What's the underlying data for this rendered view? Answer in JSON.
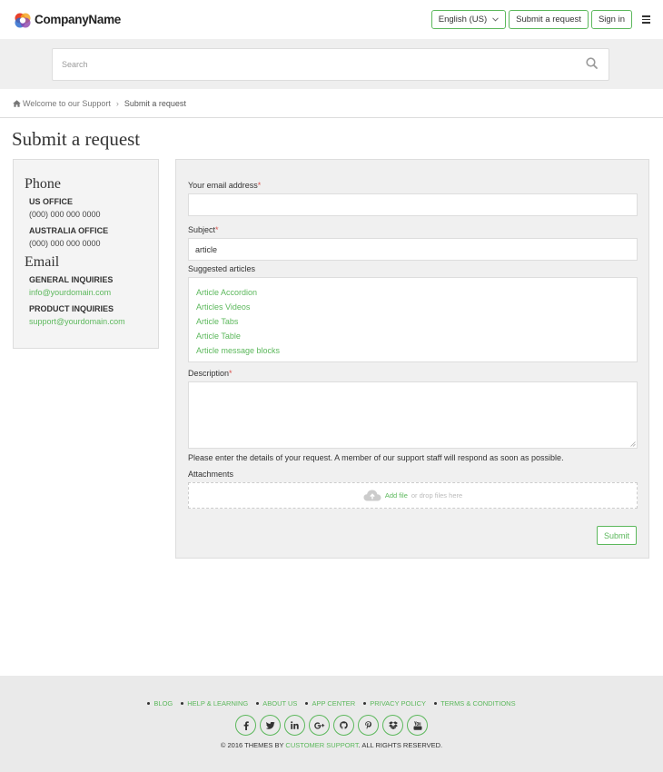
{
  "header": {
    "logo_text": "CompanyName",
    "language": "English (US)",
    "submit_request": "Submit a request",
    "sign_in": "Sign in",
    "menu_icon": "hamburger-icon"
  },
  "search": {
    "placeholder": "Search",
    "icon": "search-icon"
  },
  "breadcrumb": {
    "home": "Welcome to our Support",
    "separator": "›",
    "current": "Submit a request"
  },
  "page_title": "Submit a request",
  "sidebar": {
    "phone_heading": "Phone",
    "us_office_label": "US OFFICE",
    "us_office_phone": "(000) 000 000 0000",
    "au_office_label": "AUSTRALIA OFFICE",
    "au_office_phone": "(000) 000 000 0000",
    "email_heading": "Email",
    "general_label": "GENERAL INQUIRIES",
    "general_email": "info@yourdomain.com",
    "product_label": "PRODUCT INQUIRIES",
    "product_email": "support@yourdomain.com"
  },
  "form": {
    "email_label": "Your email address",
    "email_value": "",
    "subject_label": "Subject",
    "subject_value": "article",
    "suggested_label": "Suggested articles",
    "suggested_articles": [
      "Article Accordion",
      "Articles Videos",
      "Article Tabs",
      "Article Table",
      "Article message blocks"
    ],
    "description_label": "Description",
    "required_mark": "*",
    "help_text": "Please enter the details of your request. A member of our support staff will respond as soon as possible.",
    "attachments_label": "Attachments",
    "add_file": "Add file",
    "drop_hint": "or drop files here",
    "submit": "Submit"
  },
  "footer": {
    "links": [
      "BLOG",
      "HELP & LEARNING",
      "ABOUT US",
      "APP CENTER",
      "PRIVACY POLICY",
      "TERMS & CONDITIONS"
    ],
    "social": [
      "f",
      "t",
      "in",
      "G+",
      "gh",
      "p",
      "db",
      "yt"
    ],
    "copyright_prefix": "© 2016 THEMES BY ",
    "copyright_link": "CUSTOMER SUPPORT",
    "copyright_suffix": ". ALL RIGHTS RESERVED."
  },
  "colors": {
    "accent": "#5cb85c",
    "required": "#d9534f",
    "panel_bg": "#f0f0f0"
  }
}
